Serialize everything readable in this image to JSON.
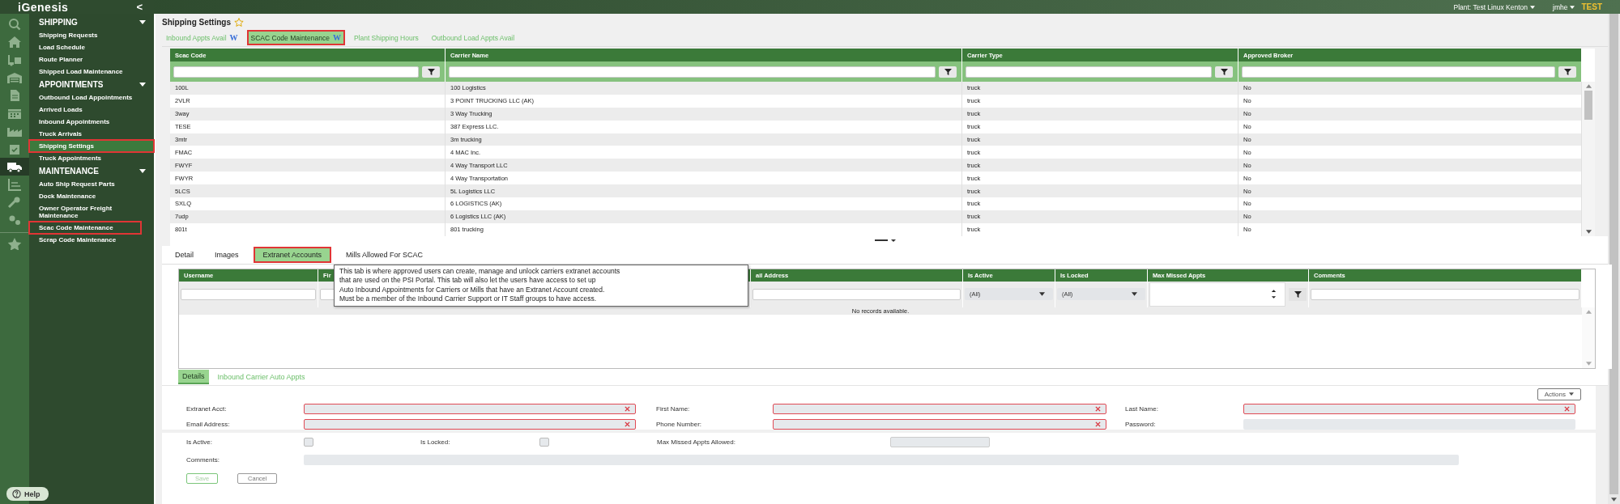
{
  "topbar": {
    "logo": "iGenesis",
    "collapse": "<",
    "plant": "Plant: Test Linux Kenton",
    "user": "jmhe",
    "environment": "TEST"
  },
  "rail": [
    {
      "kind": "search",
      "selected": false
    },
    {
      "kind": "home",
      "selected": false
    },
    {
      "kind": "forklift",
      "selected": false
    },
    {
      "kind": "warehouse",
      "selected": false
    },
    {
      "kind": "document",
      "selected": false
    },
    {
      "kind": "calendar",
      "selected": false
    },
    {
      "kind": "factory",
      "selected": false
    },
    {
      "kind": "clipboard",
      "selected": false
    },
    {
      "kind": "truck",
      "selected": true
    },
    {
      "kind": "chart",
      "selected": false
    },
    {
      "kind": "wrench",
      "selected": false
    },
    {
      "kind": "gears",
      "selected": false
    },
    {
      "kind": "star",
      "selected": false
    }
  ],
  "menu": [
    {
      "title": "SHIPPING",
      "expanded": true,
      "items": [
        {
          "label": "Shipping Requests",
          "selected": false,
          "highlighted": false
        },
        {
          "label": "Load Schedule",
          "selected": false,
          "highlighted": false
        },
        {
          "label": "Route Planner",
          "selected": false,
          "highlighted": false
        },
        {
          "label": "Shipped Load Maintenance",
          "selected": false,
          "highlighted": false
        }
      ]
    },
    {
      "title": "APPOINTMENTS",
      "expanded": true,
      "items": [
        {
          "label": "Outbound Load Appointments",
          "selected": false,
          "highlighted": false
        },
        {
          "label": "Arrived Loads",
          "selected": false,
          "highlighted": false
        },
        {
          "label": "Inbound Appointments",
          "selected": false,
          "highlighted": false
        },
        {
          "label": "Truck Arrivals",
          "selected": false,
          "highlighted": false
        },
        {
          "label": "Shipping Settings",
          "selected": true,
          "highlighted": true
        },
        {
          "label": "Truck Appointments",
          "selected": false,
          "highlighted": false
        }
      ]
    },
    {
      "title": "MAINTENANCE",
      "expanded": true,
      "items": [
        {
          "label": "Auto Ship Request Parts",
          "selected": false,
          "highlighted": false
        },
        {
          "label": "Dock Maintenance",
          "selected": false,
          "highlighted": false
        },
        {
          "label": "Owner Operator Freight Maintenance",
          "selected": false,
          "highlighted": false
        },
        {
          "label": "Scac Code Maintenance",
          "selected": false,
          "highlighted": true
        },
        {
          "label": "Scrap Code Maintenance",
          "selected": false,
          "highlighted": false
        }
      ]
    }
  ],
  "help": "Help",
  "page": {
    "title": "Shipping Settings",
    "favorite": false
  },
  "tabs": [
    {
      "label": "Inbound Appts Avail",
      "wiki": "W",
      "selected": false,
      "highlighted": false
    },
    {
      "label": "SCAC Code Maintenance",
      "wiki": "W",
      "selected": true,
      "highlighted": true
    },
    {
      "label": "Plant Shipping Hours",
      "selected": false,
      "highlighted": false
    },
    {
      "label": "Outbound Load Appts Avail",
      "selected": false,
      "highlighted": false
    }
  ],
  "carriers": {
    "columns": [
      "Scac Code",
      "Carrier Name",
      "Carrier Type",
      "Approved Broker"
    ],
    "rows": [
      [
        "100L",
        "100 Logistics",
        "truck",
        "No"
      ],
      [
        "2VLR",
        "3 POINT TRUCKING LLC (AK)",
        "truck",
        "No"
      ],
      [
        "3way",
        "3 Way Trucking",
        "truck",
        "No"
      ],
      [
        "TESE",
        "387 Express LLC.",
        "truck",
        "No"
      ],
      [
        "3mtr",
        "3m trucking",
        "truck",
        "No"
      ],
      [
        "FMAC",
        "4 MAC Inc.",
        "truck",
        "No"
      ],
      [
        "FWYF",
        "4 Way Transport LLC",
        "truck",
        "No"
      ],
      [
        "FWYR",
        "4 Way Transportation",
        "truck",
        "No"
      ],
      [
        "5LCS",
        "5L Logistics LLC",
        "truck",
        "No"
      ],
      [
        "SXLQ",
        "6 LOGISTICS (AK)",
        "truck",
        "No"
      ],
      [
        "7udp",
        "6 Logistics LLC (AK)",
        "truck",
        "No"
      ],
      [
        "801t",
        "801 trucking",
        "truck",
        "No"
      ]
    ]
  },
  "detail_tabs": [
    {
      "label": "Detail",
      "selected": false,
      "highlighted": false
    },
    {
      "label": "Images",
      "selected": false,
      "highlighted": false
    },
    {
      "label": "Extranet Accounts",
      "selected": true,
      "highlighted": true
    },
    {
      "label": "Mills Allowed For SCAC",
      "selected": false,
      "highlighted": false
    }
  ],
  "tooltip": {
    "lines": [
      "This tab is where approved users can create, manage and unlock carriers extranet accounts",
      "that are used on the PSI Portal. This tab will also let the users have access to set up",
      "Auto Inbound Appointments for Carriers or Mills that have an Extranet Account created.",
      "Must be a member of the Inbound Carrier Support or IT Staff groups to have access."
    ]
  },
  "accounts": {
    "columns": [
      {
        "label": "Username",
        "kind": "text"
      },
      {
        "label": "Fir",
        "kind": "text"
      },
      {
        "label": "ail Address",
        "kind": "text"
      },
      {
        "label": "Is Active",
        "kind": "select",
        "value": "(All)"
      },
      {
        "label": "Is Locked",
        "kind": "select",
        "value": "(All)"
      },
      {
        "label": "Max Missed Appts",
        "kind": "number"
      },
      {
        "label": "Comments",
        "kind": "text"
      }
    ],
    "empty": "No records available."
  },
  "sub_tabs": [
    {
      "label": "Details",
      "selected": true
    },
    {
      "label": "Inbound Carrier Auto Appts",
      "selected": false
    }
  ],
  "actions": "Actions",
  "form": {
    "fields": [
      {
        "label": "Extranet Acct:",
        "required": true
      },
      {
        "label": "First Name:",
        "required": true
      },
      {
        "label": "Last Name:",
        "required": true
      },
      {
        "label": "Email Address:",
        "required": true
      },
      {
        "label": "Phone Number:",
        "required": true
      },
      {
        "label": "Password:",
        "required": false
      }
    ],
    "flags": [
      {
        "label": "Is Active:",
        "checked": false
      },
      {
        "label": "Is Locked:",
        "checked": false
      }
    ],
    "max_missed": "Max Missed Appts Allowed:",
    "comments": "Comments:",
    "buttons": [
      {
        "label": "Save",
        "kind": "primary"
      },
      {
        "label": "Cancel",
        "kind": "secondary"
      }
    ]
  }
}
